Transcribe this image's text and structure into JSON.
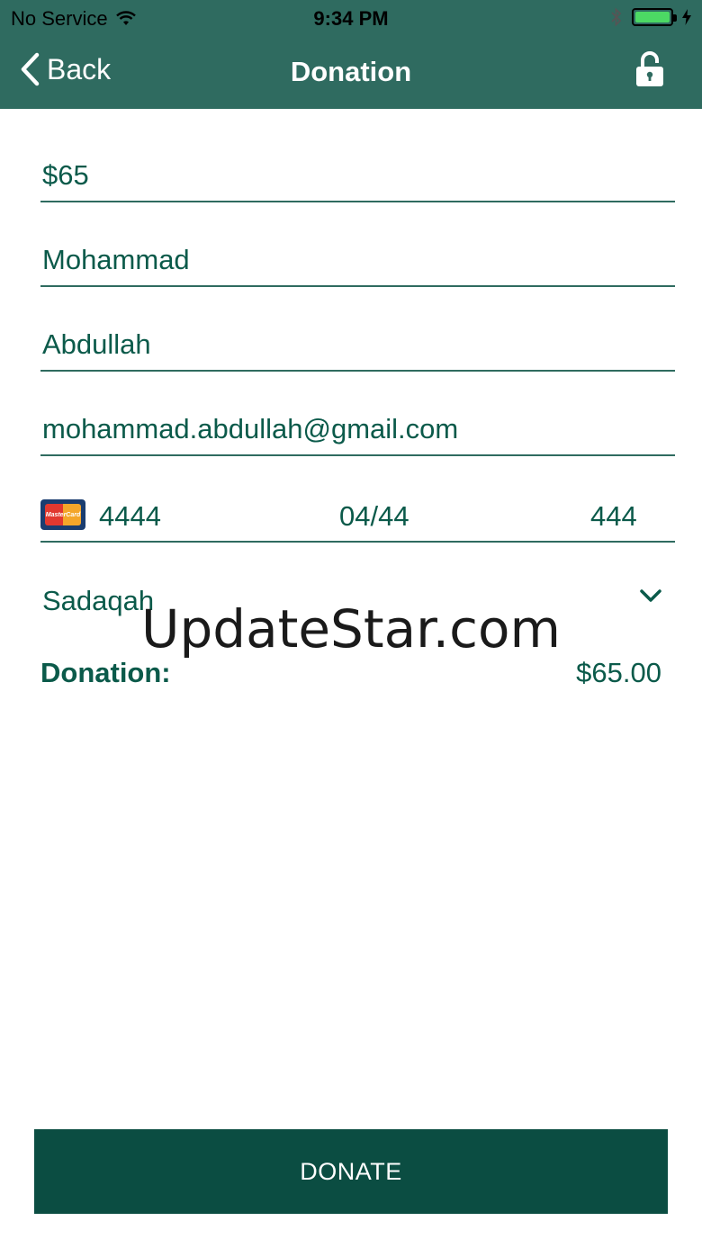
{
  "status_bar": {
    "carrier": "No Service",
    "time": "9:34 PM"
  },
  "nav": {
    "back_label": "Back",
    "title": "Donation",
    "lock_icon": "lock-icon"
  },
  "form": {
    "amount": "$65",
    "first_name": "Mohammad",
    "last_name": "Abdullah",
    "email": "mohammad.abdullah@gmail.com",
    "card": {
      "brand": "MasterCard",
      "number": "4444",
      "expiry": "04/44",
      "cvc": "444"
    },
    "donation_type": "Sadaqah"
  },
  "summary": {
    "label": "Donation:",
    "amount": "$65.00"
  },
  "watermark": "UpdateStar.com",
  "donate_label": "DONATE",
  "colors": {
    "nav_bg": "#2f6b60",
    "text": "#0b5a4a",
    "button_bg": "#0b4d42",
    "battery": "#4cd964"
  }
}
